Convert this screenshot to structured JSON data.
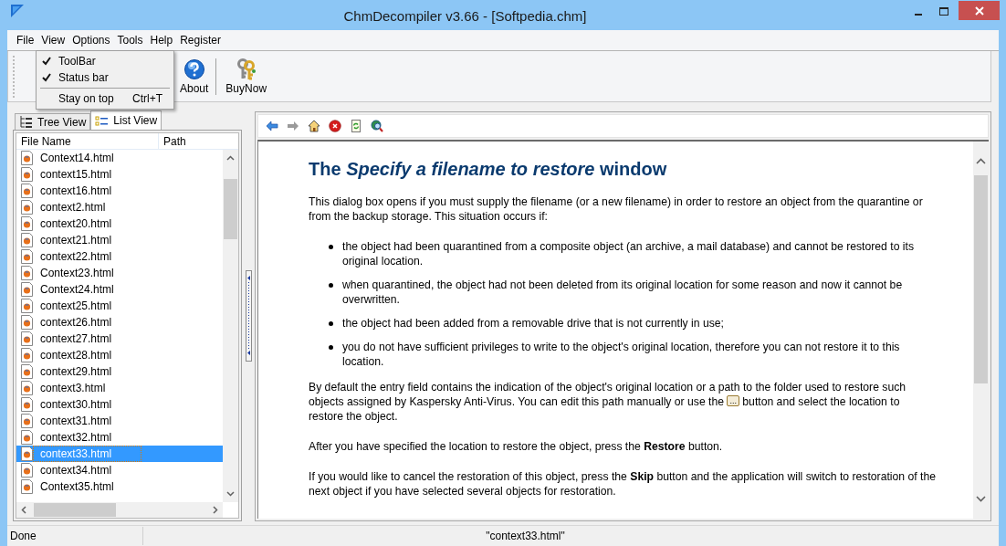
{
  "window": {
    "title": "ChmDecompiler v3.66 - [Softpedia.chm]"
  },
  "menu": [
    {
      "label": "File"
    },
    {
      "label": "View"
    },
    {
      "label": "Options"
    },
    {
      "label": "Tools"
    },
    {
      "label": "Help"
    },
    {
      "label": "Register"
    }
  ],
  "view_menu": [
    {
      "kind": "check",
      "label": "ToolBar",
      "checked": true
    },
    {
      "kind": "check",
      "label": "Status bar",
      "checked": true
    },
    {
      "kind": "separator"
    },
    {
      "kind": "command",
      "label": "Stay on top",
      "shortcut": "Ctrl+T"
    }
  ],
  "toolbar": [
    {
      "kind": "help",
      "label": "About"
    },
    {
      "kind": "keys",
      "label": "BuyNow"
    }
  ],
  "tabs": [
    {
      "label": "Tree View",
      "kind": "tree",
      "selected": false
    },
    {
      "label": "List View",
      "kind": "list",
      "selected": true
    }
  ],
  "file_list": {
    "columns": [
      "File Name",
      "Path"
    ],
    "rows": [
      {
        "name": "Context14.html",
        "selected": false
      },
      {
        "name": "context15.html",
        "selected": false
      },
      {
        "name": "context16.html",
        "selected": false
      },
      {
        "name": "context2.html",
        "selected": false
      },
      {
        "name": "context20.html",
        "selected": false
      },
      {
        "name": "context21.html",
        "selected": false
      },
      {
        "name": "context22.html",
        "selected": false
      },
      {
        "name": "Context23.html",
        "selected": false
      },
      {
        "name": "Context24.html",
        "selected": false
      },
      {
        "name": "context25.html",
        "selected": false
      },
      {
        "name": "context26.html",
        "selected": false
      },
      {
        "name": "context27.html",
        "selected": false
      },
      {
        "name": "context28.html",
        "selected": false
      },
      {
        "name": "context29.html",
        "selected": false
      },
      {
        "name": "context3.html",
        "selected": false
      },
      {
        "name": "context30.html",
        "selected": false
      },
      {
        "name": "context31.html",
        "selected": false
      },
      {
        "name": "context32.html",
        "selected": false
      },
      {
        "name": "context33.html",
        "selected": true
      },
      {
        "name": "context34.html",
        "selected": false
      },
      {
        "name": "Context35.html",
        "selected": false
      }
    ]
  },
  "document": {
    "heading": "The *Specify a filename to restore* window",
    "intro": "This dialog box opens if you must supply the filename (or a new filename) in order to restore an object from the quarantine or from the backup storage. This situation occurs if:",
    "bullets": [
      "the object had been quarantined from a composite object (an archive, a mail database) and cannot be restored to its original location.",
      "when quarantined, the object had not been deleted from its original location for some reason and now it cannot be overwritten.",
      "the object had been added from a removable drive that is not currently in use;",
      "you do not have sufficient privileges to write to the object's original location, therefore you can not restore it to this location."
    ],
    "entry_paragraph": {
      "before": "By default the entry field contains the indication of the object's original location or a path to the folder used to restore such objects assigned by Kaspersky Anti-Virus. You can edit this path manually or use the",
      "button": "...",
      "after": "button and select the location to restore the object."
    },
    "paragraphs": [
      "After you have specified the location to restore the object, press the **Restore** button.",
      "If you would like to cancel the restoration of this object, press the **Skip** button and the application will switch to restoration of the next object if you have selected several objects for restoration."
    ]
  },
  "status_bar": {
    "state": "Done",
    "file": "\"context33.html\""
  }
}
